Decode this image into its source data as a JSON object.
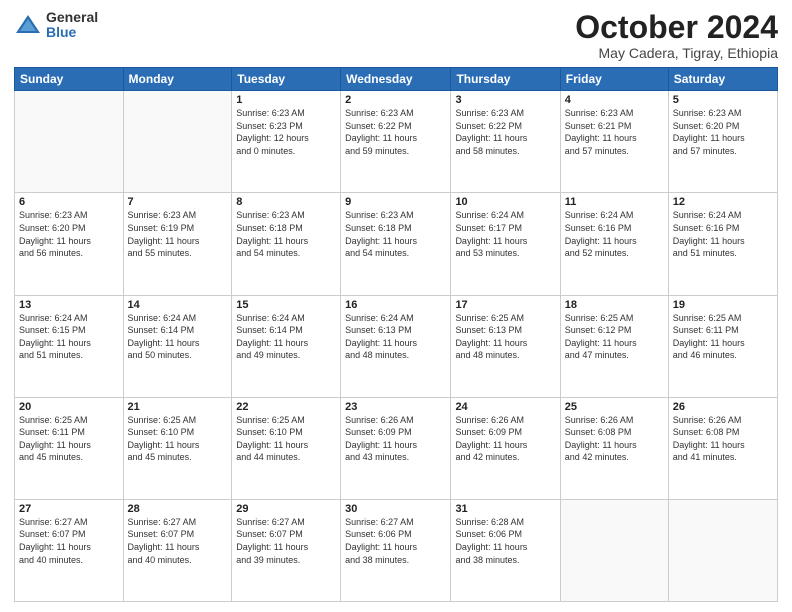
{
  "logo": {
    "general": "General",
    "blue": "Blue"
  },
  "header": {
    "month": "October 2024",
    "location": "May Cadera, Tigray, Ethiopia"
  },
  "days_of_week": [
    "Sunday",
    "Monday",
    "Tuesday",
    "Wednesday",
    "Thursday",
    "Friday",
    "Saturday"
  ],
  "weeks": [
    [
      {
        "day": "",
        "lines": []
      },
      {
        "day": "",
        "lines": []
      },
      {
        "day": "1",
        "lines": [
          "Sunrise: 6:23 AM",
          "Sunset: 6:23 PM",
          "Daylight: 12 hours",
          "and 0 minutes."
        ]
      },
      {
        "day": "2",
        "lines": [
          "Sunrise: 6:23 AM",
          "Sunset: 6:22 PM",
          "Daylight: 11 hours",
          "and 59 minutes."
        ]
      },
      {
        "day": "3",
        "lines": [
          "Sunrise: 6:23 AM",
          "Sunset: 6:22 PM",
          "Daylight: 11 hours",
          "and 58 minutes."
        ]
      },
      {
        "day": "4",
        "lines": [
          "Sunrise: 6:23 AM",
          "Sunset: 6:21 PM",
          "Daylight: 11 hours",
          "and 57 minutes."
        ]
      },
      {
        "day": "5",
        "lines": [
          "Sunrise: 6:23 AM",
          "Sunset: 6:20 PM",
          "Daylight: 11 hours",
          "and 57 minutes."
        ]
      }
    ],
    [
      {
        "day": "6",
        "lines": [
          "Sunrise: 6:23 AM",
          "Sunset: 6:20 PM",
          "Daylight: 11 hours",
          "and 56 minutes."
        ]
      },
      {
        "day": "7",
        "lines": [
          "Sunrise: 6:23 AM",
          "Sunset: 6:19 PM",
          "Daylight: 11 hours",
          "and 55 minutes."
        ]
      },
      {
        "day": "8",
        "lines": [
          "Sunrise: 6:23 AM",
          "Sunset: 6:18 PM",
          "Daylight: 11 hours",
          "and 54 minutes."
        ]
      },
      {
        "day": "9",
        "lines": [
          "Sunrise: 6:23 AM",
          "Sunset: 6:18 PM",
          "Daylight: 11 hours",
          "and 54 minutes."
        ]
      },
      {
        "day": "10",
        "lines": [
          "Sunrise: 6:24 AM",
          "Sunset: 6:17 PM",
          "Daylight: 11 hours",
          "and 53 minutes."
        ]
      },
      {
        "day": "11",
        "lines": [
          "Sunrise: 6:24 AM",
          "Sunset: 6:16 PM",
          "Daylight: 11 hours",
          "and 52 minutes."
        ]
      },
      {
        "day": "12",
        "lines": [
          "Sunrise: 6:24 AM",
          "Sunset: 6:16 PM",
          "Daylight: 11 hours",
          "and 51 minutes."
        ]
      }
    ],
    [
      {
        "day": "13",
        "lines": [
          "Sunrise: 6:24 AM",
          "Sunset: 6:15 PM",
          "Daylight: 11 hours",
          "and 51 minutes."
        ]
      },
      {
        "day": "14",
        "lines": [
          "Sunrise: 6:24 AM",
          "Sunset: 6:14 PM",
          "Daylight: 11 hours",
          "and 50 minutes."
        ]
      },
      {
        "day": "15",
        "lines": [
          "Sunrise: 6:24 AM",
          "Sunset: 6:14 PM",
          "Daylight: 11 hours",
          "and 49 minutes."
        ]
      },
      {
        "day": "16",
        "lines": [
          "Sunrise: 6:24 AM",
          "Sunset: 6:13 PM",
          "Daylight: 11 hours",
          "and 48 minutes."
        ]
      },
      {
        "day": "17",
        "lines": [
          "Sunrise: 6:25 AM",
          "Sunset: 6:13 PM",
          "Daylight: 11 hours",
          "and 48 minutes."
        ]
      },
      {
        "day": "18",
        "lines": [
          "Sunrise: 6:25 AM",
          "Sunset: 6:12 PM",
          "Daylight: 11 hours",
          "and 47 minutes."
        ]
      },
      {
        "day": "19",
        "lines": [
          "Sunrise: 6:25 AM",
          "Sunset: 6:11 PM",
          "Daylight: 11 hours",
          "and 46 minutes."
        ]
      }
    ],
    [
      {
        "day": "20",
        "lines": [
          "Sunrise: 6:25 AM",
          "Sunset: 6:11 PM",
          "Daylight: 11 hours",
          "and 45 minutes."
        ]
      },
      {
        "day": "21",
        "lines": [
          "Sunrise: 6:25 AM",
          "Sunset: 6:10 PM",
          "Daylight: 11 hours",
          "and 45 minutes."
        ]
      },
      {
        "day": "22",
        "lines": [
          "Sunrise: 6:25 AM",
          "Sunset: 6:10 PM",
          "Daylight: 11 hours",
          "and 44 minutes."
        ]
      },
      {
        "day": "23",
        "lines": [
          "Sunrise: 6:26 AM",
          "Sunset: 6:09 PM",
          "Daylight: 11 hours",
          "and 43 minutes."
        ]
      },
      {
        "day": "24",
        "lines": [
          "Sunrise: 6:26 AM",
          "Sunset: 6:09 PM",
          "Daylight: 11 hours",
          "and 42 minutes."
        ]
      },
      {
        "day": "25",
        "lines": [
          "Sunrise: 6:26 AM",
          "Sunset: 6:08 PM",
          "Daylight: 11 hours",
          "and 42 minutes."
        ]
      },
      {
        "day": "26",
        "lines": [
          "Sunrise: 6:26 AM",
          "Sunset: 6:08 PM",
          "Daylight: 11 hours",
          "and 41 minutes."
        ]
      }
    ],
    [
      {
        "day": "27",
        "lines": [
          "Sunrise: 6:27 AM",
          "Sunset: 6:07 PM",
          "Daylight: 11 hours",
          "and 40 minutes."
        ]
      },
      {
        "day": "28",
        "lines": [
          "Sunrise: 6:27 AM",
          "Sunset: 6:07 PM",
          "Daylight: 11 hours",
          "and 40 minutes."
        ]
      },
      {
        "day": "29",
        "lines": [
          "Sunrise: 6:27 AM",
          "Sunset: 6:07 PM",
          "Daylight: 11 hours",
          "and 39 minutes."
        ]
      },
      {
        "day": "30",
        "lines": [
          "Sunrise: 6:27 AM",
          "Sunset: 6:06 PM",
          "Daylight: 11 hours",
          "and 38 minutes."
        ]
      },
      {
        "day": "31",
        "lines": [
          "Sunrise: 6:28 AM",
          "Sunset: 6:06 PM",
          "Daylight: 11 hours",
          "and 38 minutes."
        ]
      },
      {
        "day": "",
        "lines": []
      },
      {
        "day": "",
        "lines": []
      }
    ]
  ]
}
